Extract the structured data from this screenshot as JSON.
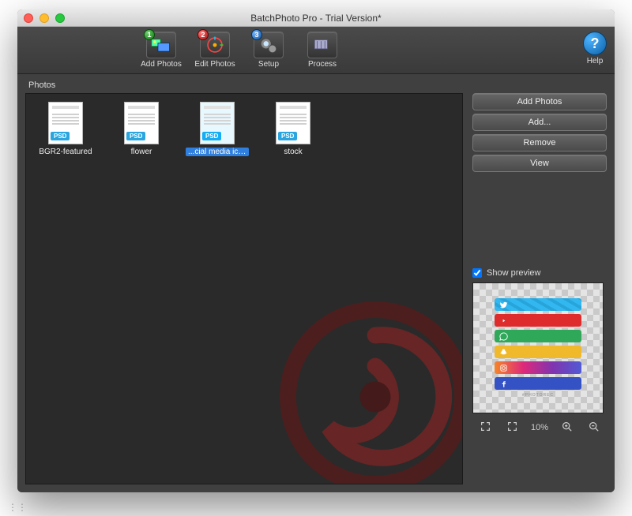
{
  "window": {
    "title": "BatchPhoto Pro - Trial Version*"
  },
  "toolbar": {
    "items": [
      {
        "label": "Add Photos",
        "badge": "1"
      },
      {
        "label": "Edit Photos",
        "badge": "2"
      },
      {
        "label": "Setup",
        "badge": "3"
      },
      {
        "label": "Process",
        "badge": ""
      }
    ],
    "help_label": "Help"
  },
  "photos": {
    "section_label": "Photos",
    "files": [
      {
        "label": "BGR2-featured",
        "selected": false
      },
      {
        "label": "flower",
        "selected": false
      },
      {
        "label": "...cial media icons",
        "selected": true
      },
      {
        "label": "stock",
        "selected": false
      }
    ],
    "psd_tag": "PSD"
  },
  "side_buttons": {
    "add_photos": "Add Photos",
    "add_more": "Add...",
    "remove": "Remove",
    "view": "View"
  },
  "preview": {
    "checkbox_label": "Show preview",
    "checked": true,
    "zoom_label": "10%",
    "tiny_label": "#PHOTOREC"
  }
}
